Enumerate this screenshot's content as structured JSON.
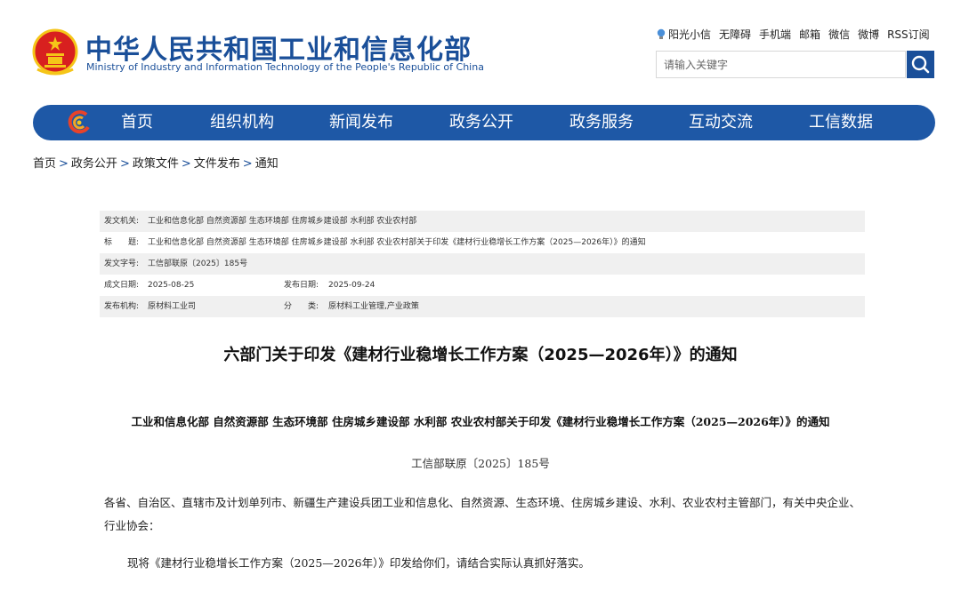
{
  "header": {
    "title_cn": "中华人民共和国工业和信息化部",
    "title_en": "Ministry of Industry and Information Technology of the People's Republic of China",
    "emblem_icon": "national-emblem-icon",
    "top_links": [
      "阳光小信",
      "无障碍",
      "手机端",
      "邮箱",
      "微信",
      "微博",
      "RSS订阅"
    ],
    "search": {
      "placeholder": "请输入关键字",
      "icon": "search-icon"
    }
  },
  "nav": {
    "logo_icon": "miit-logo-icon",
    "items": [
      "首页",
      "组织机构",
      "新闻发布",
      "政务公开",
      "政务服务",
      "互动交流",
      "工信数据"
    ]
  },
  "breadcrumb": [
    "首页",
    "政务公开",
    "政策文件",
    "文件发布",
    "通知"
  ],
  "info": {
    "issuer_label": "发文机关:",
    "issuer_value": "工业和信息化部 自然资源部 生态环境部 住房城乡建设部 水利部 农业农村部",
    "title_label": "标　　题:",
    "title_value": "工业和信息化部 自然资源部 生态环境部 住房城乡建设部 水利部 农业农村部关于印发《建材行业稳增长工作方案（2025—2026年）》的通知",
    "docno_label": "发文字号:",
    "docno_value": "工信部联原〔2025〕185号",
    "created_label": "成文日期:",
    "created_value": "2025-08-25",
    "published_label": "发布日期:",
    "published_value": "2025-09-24",
    "org_label": "发布机构:",
    "org_value": "原材料工业司",
    "category_label": "分　　类:",
    "category_value": "原材料工业管理,产业政策"
  },
  "document": {
    "title": "六部门关于印发《建材行业稳增长工作方案（2025—2026年）》的通知",
    "subheading": "工业和信息化部 自然资源部 生态环境部 住房城乡建设部 水利部 农业农村部关于印发《建材行业稳增长工作方案（2025—2026年）》的通知",
    "number": "工信部联原〔2025〕185号",
    "para1": "各省、自治区、直辖市及计划单列市、新疆生产建设兵团工业和信息化、自然资源、生态环境、住房城乡建设、水利、农业农村主管部门，有关中央企业、行业协会：",
    "para2": "现将《建材行业稳增长工作方案（2025—2026年）》印发给你们，请结合实际认真抓好落实。"
  },
  "colors": {
    "brand_blue": "#1a4f99",
    "nav_blue": "#1e58a6",
    "emblem_red": "#d8201f",
    "emblem_gold": "#f5c518"
  }
}
